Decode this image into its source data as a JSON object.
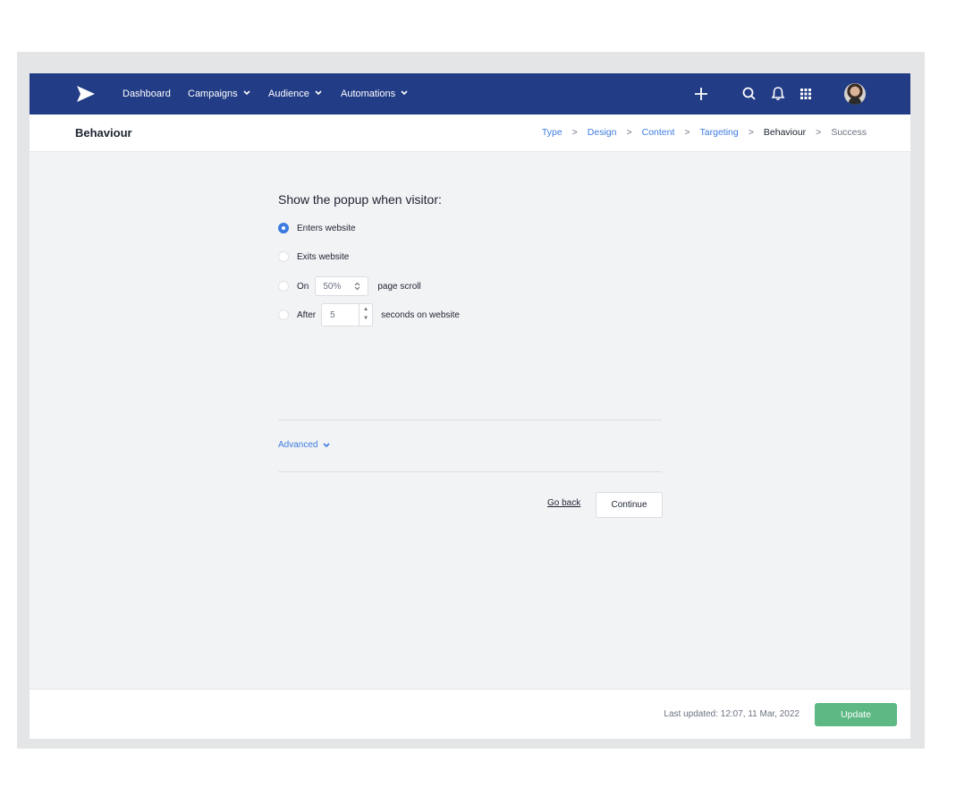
{
  "nav": {
    "items": [
      "Dashboard",
      "Campaigns",
      "Audience",
      "Automations"
    ]
  },
  "header": {
    "title": "Behaviour",
    "breadcrumbs": [
      "Type",
      "Design",
      "Content",
      "Targeting",
      "Behaviour",
      "Success"
    ]
  },
  "form": {
    "heading": "Show the popup when visitor:",
    "options": {
      "enters": "Enters website",
      "exits": "Exits website",
      "on": "On",
      "on_suffix": "page scroll",
      "after": "After",
      "after_suffix": "seconds on website"
    },
    "scroll_value": "50%",
    "seconds_value": "5",
    "advanced": "Advanced",
    "go_back": "Go back",
    "continue": "Continue"
  },
  "footer": {
    "last_updated": "Last updated: 12:07, 11 Mar, 2022",
    "update": "Update"
  },
  "colors": {
    "nav_bg": "#223c86",
    "link": "#3d7be0",
    "update_green": "#5db883"
  },
  "icons": [
    "send-logo-icon",
    "chevron-down-icon",
    "plus-icon",
    "search-icon",
    "bell-icon",
    "apps-grid-icon",
    "avatar"
  ]
}
